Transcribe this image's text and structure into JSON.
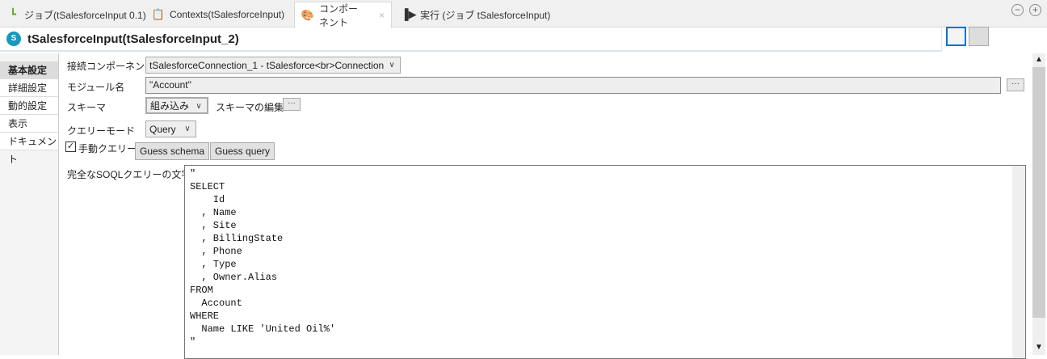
{
  "tabs": [
    {
      "label": "ジョブ(tSalesforceInput 0.1)",
      "icon": "job-icon"
    },
    {
      "label": "Contexts(tSalesforceInput)",
      "icon": "contexts-icon"
    },
    {
      "label": "コンポーネント",
      "icon": "palette-icon",
      "close": "×"
    },
    {
      "label": "実行 (ジョブ tSalesforceInput)",
      "icon": "run-icon"
    }
  ],
  "window": {
    "minimize": "−",
    "maximize": "+"
  },
  "header": {
    "title": "tSalesforceInput(tSalesforceInput_2)"
  },
  "sidebar": [
    "基本設定",
    "詳細設定",
    "動的設定",
    "表示",
    "ドキュメント"
  ],
  "form": {
    "connection_label": "接続コンポーネント",
    "connection_value": "tSalesforceConnection_1 - tSalesforce<br>Connection",
    "module_label": "モジュール名",
    "module_value": "\"Account\"",
    "module_btn": "···",
    "schema_label": "スキーマ",
    "schema_value": "組み込み",
    "schema_edit_label": "スキーマの編集",
    "schema_edit_btn": "···",
    "query_mode_label": "クエリーモード",
    "query_mode_value": "Query",
    "manual_query_label": "手動クエリー",
    "manual_query_checked": true,
    "guess_schema": "Guess schema",
    "guess_query": "Guess query",
    "soql_label": "完全なSOQLクエリーの文字列",
    "soql_value": "\"\nSELECT\n    Id\n  , Name\n  , Site\n  , BillingState\n  , Phone\n  , Type\n  , Owner.Alias\nFROM\n  Account\nWHERE\n  Name LIKE 'United Oil%'\n\""
  }
}
